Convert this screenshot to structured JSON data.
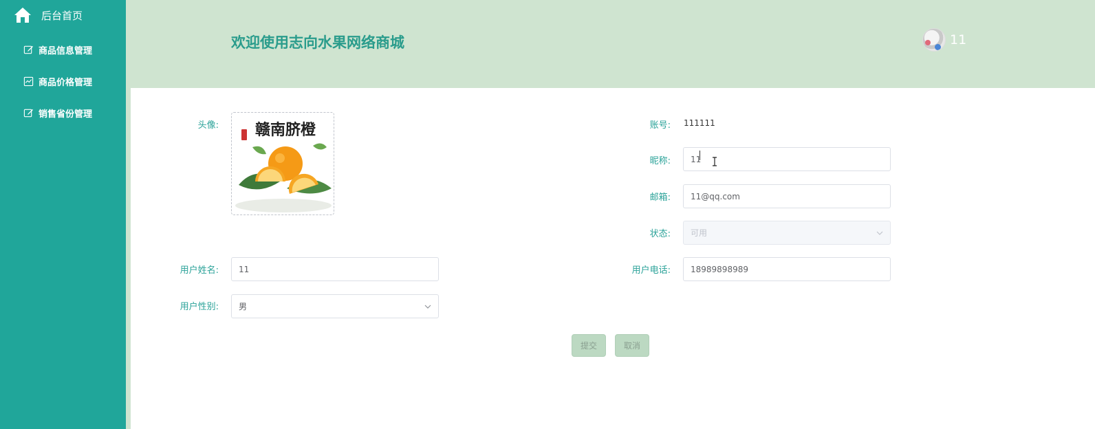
{
  "sidebar": {
    "home_label": "后台首页",
    "items": [
      {
        "label": "商品信息管理",
        "icon": "edit-icon"
      },
      {
        "label": "商品价格管理",
        "icon": "chart-icon"
      },
      {
        "label": "销售省份管理",
        "icon": "edit-icon"
      }
    ]
  },
  "header": {
    "title": "欢迎使用志向水果网络商城",
    "user_name": "11"
  },
  "form": {
    "avatar_label": "头像:",
    "avatar_image_text": "赣南脐橙",
    "account_label": "账号:",
    "account_value": "111111",
    "nickname_label": "昵称:",
    "nickname_value": "11",
    "email_label": "邮箱:",
    "email_value": "11@qq.com",
    "status_label": "状态:",
    "status_value": "可用",
    "name_label": "用户姓名:",
    "name_value": "11",
    "phone_label": "用户电话:",
    "phone_value": "18989898989",
    "gender_label": "用户性别:",
    "gender_value": "男",
    "submit_label": "提交",
    "cancel_label": "取消"
  },
  "colors": {
    "sidebar": "#20a69a",
    "header": "#cfe4d0",
    "accent": "#2a9c8c",
    "button": "#bcd9c2"
  }
}
